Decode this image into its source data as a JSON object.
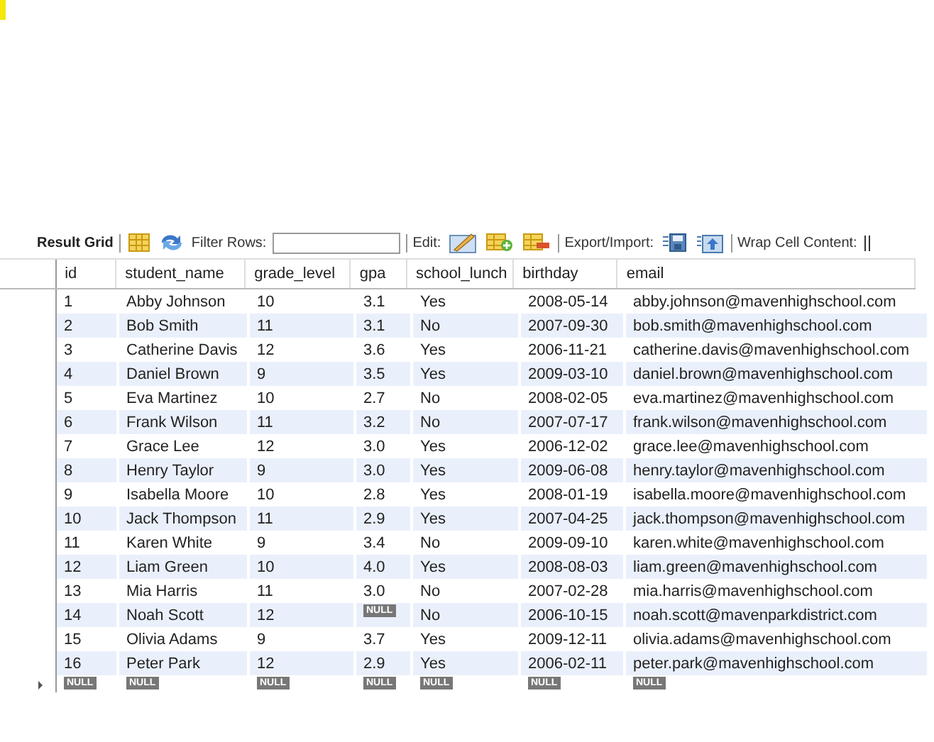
{
  "toolbar": {
    "title": "Result Grid",
    "filter_label": "Filter Rows:",
    "edit_label": "Edit:",
    "export_label": "Export/Import:",
    "wrap_label": "Wrap Cell Content:"
  },
  "table": {
    "columns": [
      "id",
      "student_name",
      "grade_level",
      "gpa",
      "school_lunch",
      "birthday",
      "email"
    ],
    "rows": [
      [
        "1",
        "Abby Johnson",
        "10",
        "3.1",
        "Yes",
        "2008-05-14",
        "abby.johnson@mavenhighschool.com"
      ],
      [
        "2",
        "Bob Smith",
        "11",
        "3.1",
        "No",
        "2007-09-30",
        "bob.smith@mavenhighschool.com"
      ],
      [
        "3",
        "Catherine Davis",
        "12",
        "3.6",
        "Yes",
        "2006-11-21",
        "catherine.davis@mavenhighschool.com"
      ],
      [
        "4",
        "Daniel Brown",
        "9",
        "3.5",
        "Yes",
        "2009-03-10",
        "daniel.brown@mavenhighschool.com"
      ],
      [
        "5",
        "Eva Martinez",
        "10",
        "2.7",
        "No",
        "2008-02-05",
        "eva.martinez@mavenhighschool.com"
      ],
      [
        "6",
        "Frank Wilson",
        "11",
        "3.2",
        "No",
        "2007-07-17",
        "frank.wilson@mavenhighschool.com"
      ],
      [
        "7",
        "Grace Lee",
        "12",
        "3.0",
        "Yes",
        "2006-12-02",
        "grace.lee@mavenhighschool.com"
      ],
      [
        "8",
        "Henry Taylor",
        "9",
        "3.0",
        "Yes",
        "2009-06-08",
        "henry.taylor@mavenhighschool.com"
      ],
      [
        "9",
        "Isabella Moore",
        "10",
        "2.8",
        "Yes",
        "2008-01-19",
        "isabella.moore@mavenhighschool.com"
      ],
      [
        "10",
        "Jack Thompson",
        "11",
        "2.9",
        "Yes",
        "2007-04-25",
        "jack.thompson@mavenhighschool.com"
      ],
      [
        "11",
        "Karen White",
        "9",
        "3.4",
        "No",
        "2009-09-10",
        "karen.white@mavenhighschool.com"
      ],
      [
        "12",
        "Liam Green",
        "10",
        "4.0",
        "Yes",
        "2008-08-03",
        "liam.green@mavenhighschool.com"
      ],
      [
        "13",
        "Mia Harris",
        "11",
        "3.0",
        "No",
        "2007-02-28",
        "mia.harris@mavenhighschool.com"
      ],
      [
        "14",
        "Noah Scott",
        "12",
        {
          "kind": "null",
          "text": "NULL"
        },
        "No",
        "2006-10-15",
        "noah.scott@mavenparkdistrict.com"
      ],
      [
        "15",
        "Olivia Adams",
        "9",
        "3.7",
        "Yes",
        "2009-12-11",
        "olivia.adams@mavenhighschool.com"
      ],
      [
        "16",
        "Peter Park",
        "12",
        "2.9",
        "Yes",
        "2006-02-11",
        "peter.park@mavenhighschool.com"
      ]
    ],
    "new_row": [
      {
        "kind": "null",
        "text": "NULL"
      },
      {
        "kind": "null",
        "text": "NULL"
      },
      {
        "kind": "null",
        "text": "NULL"
      },
      {
        "kind": "null",
        "text": "NULL"
      },
      {
        "kind": "null",
        "text": "NULL"
      },
      {
        "kind": "null",
        "text": "NULL"
      },
      {
        "kind": "null",
        "text": "NULL"
      }
    ]
  }
}
